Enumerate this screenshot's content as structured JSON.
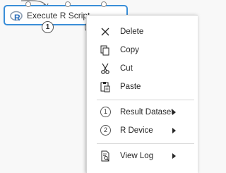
{
  "module": {
    "title": "Execute R Script",
    "output_ports": [
      "1",
      "2"
    ]
  },
  "context_menu": {
    "items": [
      {
        "label": "Delete",
        "icon": "close-icon"
      },
      {
        "label": "Copy",
        "icon": "copy-icon"
      },
      {
        "label": "Cut",
        "icon": "scissors-icon"
      },
      {
        "label": "Paste",
        "icon": "paste-icon"
      },
      {
        "label": "Result Dataset",
        "icon": "port-1-icon",
        "number": "1",
        "submenu": true
      },
      {
        "label": "R Device",
        "icon": "port-2-icon",
        "number": "2",
        "submenu": true
      },
      {
        "label": "View Log",
        "icon": "log-icon",
        "submenu": true
      }
    ]
  },
  "colors": {
    "module_border": "#3a8ed8",
    "r_logo": "#2a6ebb"
  }
}
